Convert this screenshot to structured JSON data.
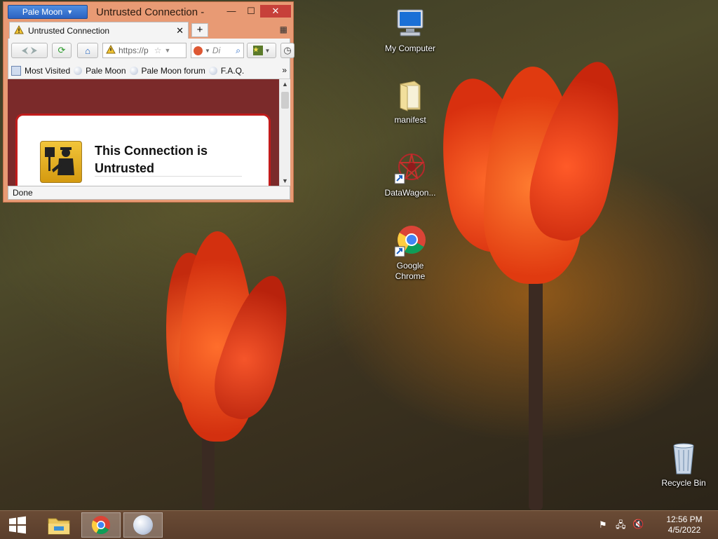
{
  "window": {
    "app_button": "Pale Moon",
    "title": "Untrusted Connection -",
    "controls": {
      "minimize": "—",
      "maximize": "☐",
      "close": "✕"
    },
    "tab_label": "Untrusted Connection",
    "tab_close": "✕",
    "new_tab": "+",
    "url_text": "https://p",
    "search_text": "Di",
    "bookmarks": [
      "Most Visited",
      "Pale Moon",
      "Pale Moon forum",
      "F.A.Q."
    ],
    "bookmarks_more": "»",
    "content_heading": "This Connection is Untrusted",
    "status": "Done"
  },
  "desktop_icons": [
    {
      "label": "My Computer"
    },
    {
      "label": "manifest"
    },
    {
      "label": "DataWagon..."
    },
    {
      "label": "Google Chrome"
    },
    {
      "label": "Recycle Bin"
    }
  ],
  "taskbar": {
    "time": "12:56 PM",
    "date": "4/5/2022"
  },
  "colors": {
    "accent_app_button": "#2b63c2",
    "close_button": "#c7403a",
    "content_bg": "#7b2a2a",
    "card_border": "#c21b1b"
  }
}
